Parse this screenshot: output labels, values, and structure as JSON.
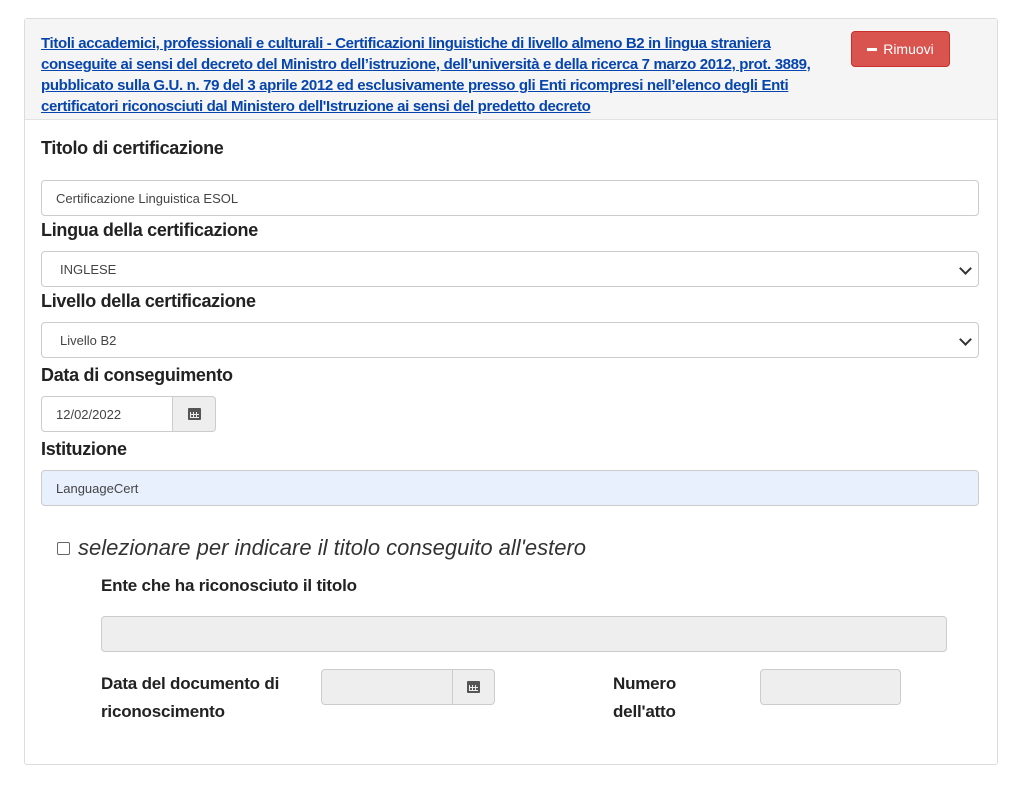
{
  "header": {
    "title": "Titoli accademici, professionali e culturali - Certificazioni linguistiche di livello almeno B2 in lingua straniera conseguite ai sensi del decreto del Ministro dell’istruzione, dell’università e della ricerca 7 marzo 2012, prot. 3889, pubblicato sulla G.U. n. 79 del 3 aprile 2012 ed esclusivamente presso gli Enti ricompresi nell’elenco degli Enti certificatori riconosciuti dal Ministero dell'Istruzione ai sensi del predetto decreto",
    "remove_label": "Rimuovi"
  },
  "form": {
    "titolo_label": "Titolo di certificazione",
    "titolo_value": "Certificazione Linguistica ESOL",
    "lingua_label": "Lingua della certificazione",
    "lingua_value": "INGLESE",
    "livello_label": "Livello della certificazione",
    "livello_value": "Livello B2",
    "data_label": "Data di conseguimento",
    "data_value": "12/02/2022",
    "istituzione_label": "Istituzione",
    "istituzione_value": "LanguageCert"
  },
  "estero": {
    "checkbox_label": "selezionare per indicare il titolo conseguito all'estero",
    "ente_label": "Ente che ha riconosciuto il titolo",
    "ente_value": "",
    "data_doc_label_1": "Data del documento di",
    "data_doc_label_2": "riconoscimento",
    "data_doc_value": "",
    "numero_label_1": "Numero",
    "numero_label_2": "dell'atto",
    "numero_value": ""
  },
  "colors": {
    "link": "#0645ad",
    "danger": "#d9534f",
    "autofill": "#e8f0fe",
    "disabled": "#eeeeee"
  }
}
